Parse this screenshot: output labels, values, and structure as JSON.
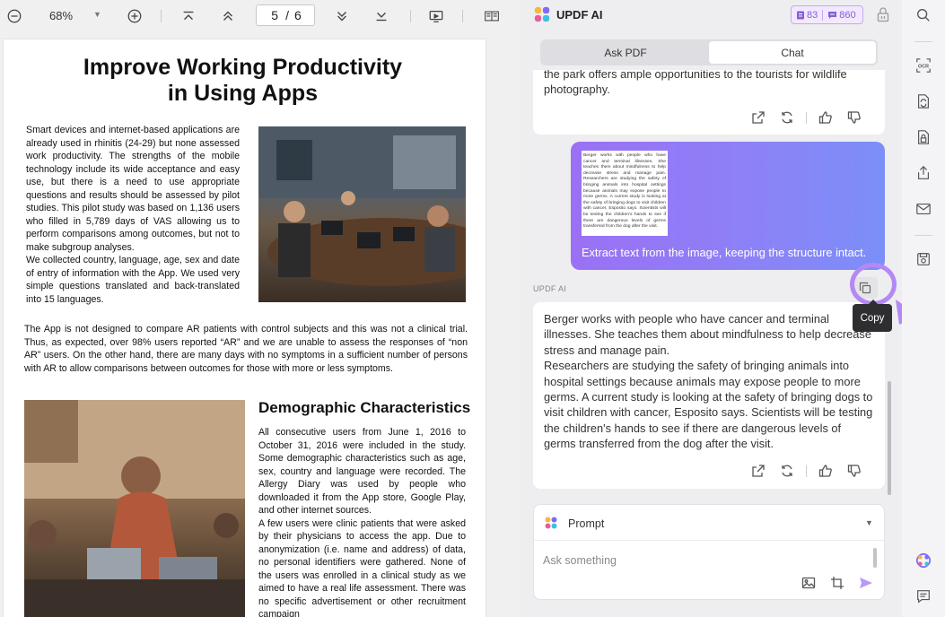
{
  "toolbar": {
    "zoom": "68%",
    "current_page": "5",
    "page_separator": "/",
    "total_pages": "6",
    "icons": [
      "zoom-out-icon",
      "zoom-in-icon",
      "first-page-icon",
      "previous-page-icon",
      "next-page-icon",
      "last-page-icon",
      "presentation-icon",
      "reading-mode-icon"
    ]
  },
  "document": {
    "title_line1": "Improve Working Productivity",
    "title_line2": "in Using Apps",
    "para1": "Smart devices and internet-based applications are already used in rhinitis (24-29) but none assessed work productivity. The strengths of the mobile technology include its wide acceptance and easy use, but there is a need to use appropriate questions and results should be assessed by pilot studies. This pilot study was based on 1,136 users who filled in 5,789 days of VAS allowing us to perform comparisons among outcomes, but not to make subgroup analyses.",
    "para1b": "We collected country, language, age, sex and date of entry of information with the App. We used very simple questions translated and back-translated into 15 languages.",
    "para2": "The App is not designed to compare AR patients with control subjects and this was not a clinical trial. Thus, as expected, over 98% users reported “AR” and we are unable to assess the responses of “non AR” users. On the other hand, there are many days with no symptoms in a sufficient number of persons with AR to allow comparisons between outcomes for those with more or less symptoms.",
    "heading2": "Demographic Characteristics",
    "para3": "All consecutive users from June 1, 2016 to October 31, 2016 were included in the study. Some demographic characteristics such as age, sex, country and language were recorded. The Allergy Diary was used by people who downloaded it from the App store, Google Play, and other internet sources.",
    "para3b": "A few users were clinic patients that were asked by their physicians to access the app. Due to anonymization (i.e. name and address) of data, no personal identifiers were gathered. None of the users was enrolled in a clinical study as we aimed to have a real life assessment. There was no specific advertisement or other recruitment campaign"
  },
  "ai_panel": {
    "title": "UPDF AI",
    "credits_a": "83",
    "credits_b": "860",
    "tabs": [
      {
        "label": "Ask PDF",
        "active": false
      },
      {
        "label": "Chat",
        "active": true
      }
    ],
    "previous_message": "the park offers ample opportunities to the tourists for wildlife photography.",
    "user_image_text": "Berger works with people who have cancer and terminal illnesses. She teaches them about mindfulness to help decrease stress and manage pain. Researchers are studying the safety of bringing animals into hospital settings because animals may expose people to more germs. A current study is looking at the safety of bringing dogs to visit children with cancer, Esposito says. Scientists will be testing the children's hands to see if there are dangerous levels of germs transferred from the dog after the visit.",
    "user_message": "Extract text from the image, keeping the structure intact.",
    "sender_label": "UPDF AI",
    "answer_p1": "Berger works with people who have cancer and terminal illnesses. She teaches them about mindfulness to help decrease stress and manage pain.",
    "answer_p2": "Researchers are studying the safety of bringing animals into hospital settings because animals may expose people to more germs. A current study is looking at the safety of bringing dogs to visit children with cancer, Esposito says. Scientists will be testing the children's hands to see if there are dangerous levels of germs transferred from the dog after the visit.",
    "tooltip": "Copy",
    "prompt_label": "Prompt",
    "input_placeholder": "Ask something"
  },
  "rail": {
    "icons": [
      "search-icon",
      "ocr-icon",
      "convert-icon",
      "protect-icon",
      "share-icon",
      "email-icon",
      "save-icon",
      "updf-ai-icon",
      "comment-icon"
    ]
  },
  "colors": {
    "accent": "#9b70f5",
    "highlight": "#b488f5",
    "panel_bg": "#eeeef0"
  }
}
